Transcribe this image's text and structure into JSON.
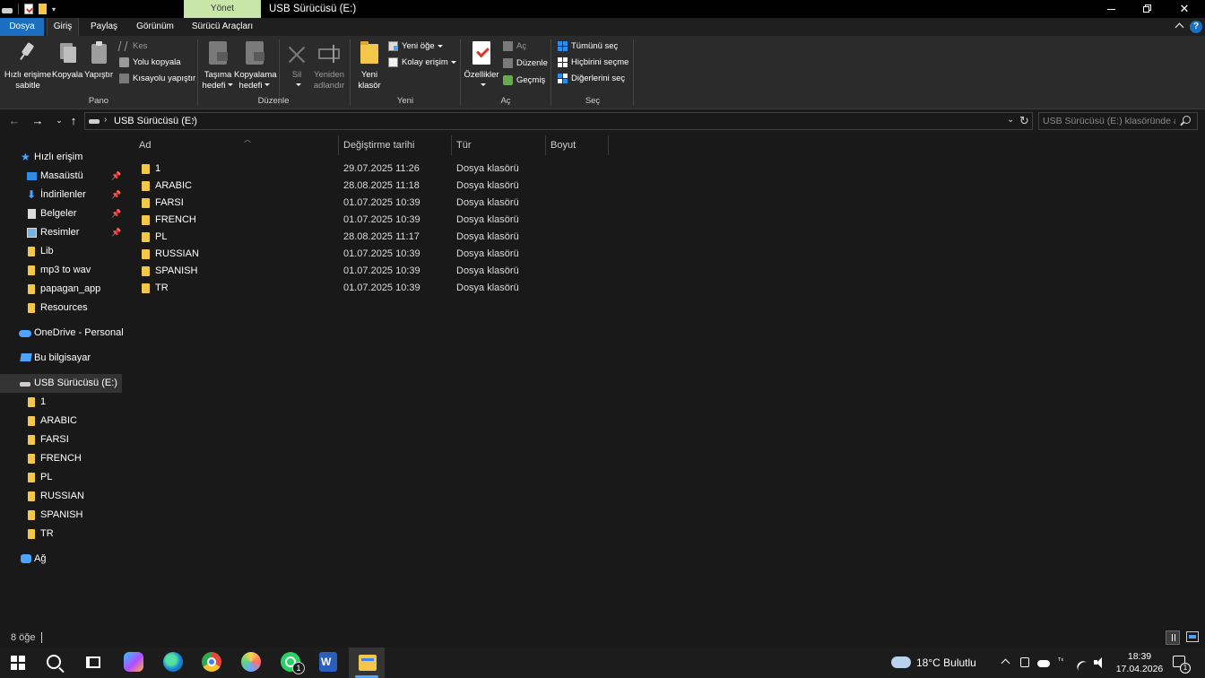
{
  "window": {
    "title": "USB Sürücüsü (E:)",
    "manage_tab": "Yönet",
    "colors": {
      "title_bg": "#000000",
      "ribbon_bg": "#2b2b2b",
      "content_bg": "#191919",
      "accent": "#1a6fc0",
      "manage_tab": "#c8e6a8",
      "folder": "#f4c64a"
    }
  },
  "ribbon_tabs": {
    "dosya": "Dosya",
    "giris": "Giriş",
    "paylas": "Paylaş",
    "gorunum": "Görünüm",
    "surucu_araclari": "Sürücü Araçları",
    "help": "?"
  },
  "ribbon": {
    "pano": {
      "label": "Pano",
      "pin_line1": "Hızlı erişime",
      "pin_line2": "sabitle",
      "copy": "Kopyala",
      "paste": "Yapıştır",
      "cut": "Kes",
      "copy_path": "Yolu kopyala",
      "paste_shortcut": "Kısayolu yapıştır"
    },
    "duzenle": {
      "label": "Düzenle",
      "move_line1": "Taşıma",
      "move_line2": "hedefi",
      "copyto_line1": "Kopyalama",
      "copyto_line2": "hedefi",
      "delete": "Sil",
      "rename_line1": "Yeniden",
      "rename_line2": "adlandır"
    },
    "yeni": {
      "label": "Yeni",
      "new_folder_line1": "Yeni",
      "new_folder_line2": "klasör",
      "new_item": "Yeni öğe",
      "easy_access": "Kolay erişim"
    },
    "ac": {
      "label": "Aç",
      "properties": "Özellikler",
      "open": "Aç",
      "edit": "Düzenle",
      "history": "Geçmiş"
    },
    "sec": {
      "label": "Seç",
      "select_all": "Tümünü seç",
      "select_none": "Hiçbirini seçme",
      "invert": "Diğerlerini seç"
    }
  },
  "address": {
    "path": "USB Sürücüsü (E:)",
    "search_placeholder": "USB Sürücüsü (E:) klasöründe a..."
  },
  "sidebar": {
    "quick_access": "Hızlı erişim",
    "quick_items": [
      {
        "label": "Masaüstü",
        "icon": "desktop-icon",
        "pinned": true
      },
      {
        "label": "İndirilenler",
        "icon": "download-icon",
        "pinned": true
      },
      {
        "label": "Belgeler",
        "icon": "documents-icon",
        "pinned": true
      },
      {
        "label": "Resimler",
        "icon": "pictures-icon",
        "pinned": true
      },
      {
        "label": "Lib",
        "icon": "folder-icon",
        "pinned": false
      },
      {
        "label": "mp3 to wav",
        "icon": "folder-icon",
        "pinned": false
      },
      {
        "label": "papagan_app",
        "icon": "folder-icon",
        "pinned": false
      },
      {
        "label": "Resources",
        "icon": "folder-icon",
        "pinned": false
      }
    ],
    "onedrive": "OneDrive - Personal",
    "this_pc": "Bu bilgisayar",
    "usb": "USB Sürücüsü (E:)",
    "usb_children": [
      "1",
      "ARABIC",
      "FARSI",
      "FRENCH",
      "PL",
      "RUSSIAN",
      "SPANISH",
      "TR"
    ],
    "network": "Ağ",
    "pin_glyph": "📌"
  },
  "columns": {
    "name": "Ad",
    "date": "Değiştirme tarihi",
    "type": "Tür",
    "size": "Boyut"
  },
  "files": [
    {
      "name": "1",
      "date": "29.07.2025 11:26",
      "type": "Dosya klasörü"
    },
    {
      "name": "ARABIC",
      "date": "28.08.2025 11:18",
      "type": "Dosya klasörü"
    },
    {
      "name": "FARSI",
      "date": "01.07.2025 10:39",
      "type": "Dosya klasörü"
    },
    {
      "name": "FRENCH",
      "date": "01.07.2025 10:39",
      "type": "Dosya klasörü"
    },
    {
      "name": "PL",
      "date": "28.08.2025 11:17",
      "type": "Dosya klasörü"
    },
    {
      "name": "RUSSIAN",
      "date": "01.07.2025 10:39",
      "type": "Dosya klasörü"
    },
    {
      "name": "SPANISH",
      "date": "01.07.2025 10:39",
      "type": "Dosya klasörü"
    },
    {
      "name": "TR",
      "date": "01.07.2025 10:39",
      "type": "Dosya klasörü"
    }
  ],
  "status": {
    "item_count": "8 öğe"
  },
  "taskbar": {
    "weather": "18°C Bulutlu",
    "whatsapp_badge": "1",
    "notification_badge": "1",
    "time": "18:39",
    "date": "17.04.2026",
    "ime": "ᵀˣ"
  }
}
